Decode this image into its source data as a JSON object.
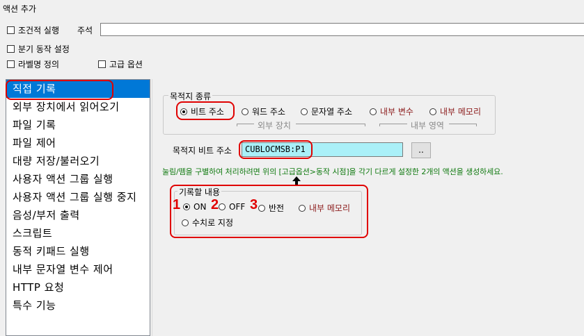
{
  "window": {
    "title": "액션 추가"
  },
  "options": {
    "conditional_exec": "조건적 실행",
    "memo_label": "주석",
    "branch_setting": "분기 동작 설정",
    "label_define": "라벨명 정의",
    "advanced_option": "고급 옵션"
  },
  "action_list": {
    "items": [
      "직접 기록",
      "외부 장치에서 읽어오기",
      "파일 기록",
      "파일 제어",
      "대량 저장/불러오기",
      "사용자 액션 그룹 실행",
      "사용자 액션 그룹 실행 중지",
      "음성/부저 출력",
      "스크립트",
      "동적 키패드 실행",
      "내부 문자열 변수 제어",
      "HTTP 요청",
      "특수 기능"
    ],
    "selected_index": 0
  },
  "target_type": {
    "legend": "목적지 종류",
    "bit_address": "비트 주소",
    "word_address": "워드 주소",
    "string_address": "문자열 주소",
    "internal_variable": "내부 변수",
    "internal_memory": "내부 메모리",
    "external_device_label": "외부 장치",
    "internal_area_label": "내부 영역"
  },
  "bit_address": {
    "label": "목적지 비트 주소",
    "value": "CUBLOCMSB:P1",
    "browse_label": ".."
  },
  "note": "눌림/뗌을 구별하여 처리하려면 위의 [고급옵션>동작 시점]을 각기 다르게 설정한 2개의 액션을 생성하세요.",
  "record_content": {
    "legend": "기록할 내용",
    "on": "ON",
    "off": "OFF",
    "invert": "반전",
    "internal_memory": "내부 메모리",
    "numeric_set": "수치로 지정"
  },
  "annotations": {
    "n1": "1",
    "n2": "2",
    "n3": "3"
  },
  "colors": {
    "selection": "#0078d7",
    "highlight_red": "#e00000",
    "address_bg": "#aaf0f8",
    "note_green": "#117a11",
    "brown_text": "#8b1a1a"
  }
}
